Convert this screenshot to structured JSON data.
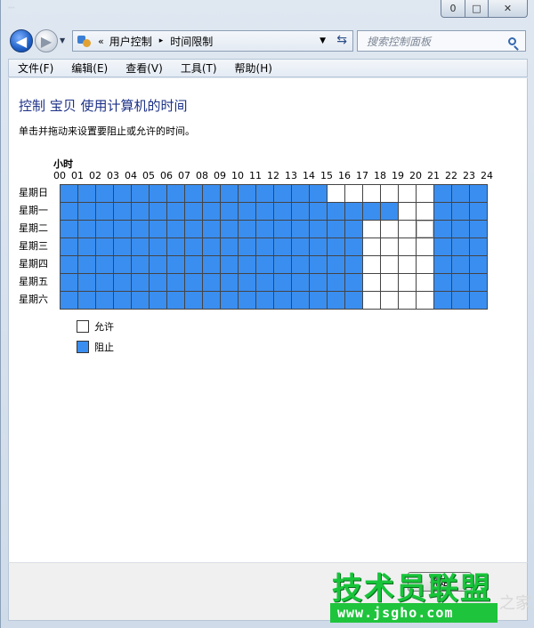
{
  "window": {
    "blurred_title": "...",
    "controls": {
      "minimize": "0",
      "maximize": "□",
      "close": "✕"
    }
  },
  "address_bar": {
    "overflow": "«",
    "crumbs": [
      "用户控制",
      "时间限制"
    ],
    "separator": "▸",
    "search_placeholder": "搜索控制面板"
  },
  "menu": [
    "文件(F)",
    "编辑(E)",
    "查看(V)",
    "工具(T)",
    "帮助(H)"
  ],
  "page": {
    "title": "控制 宝贝 使用计算机的时间",
    "instruction": "单击并拖动来设置要阻止或允许的时间。"
  },
  "grid": {
    "hours_label": "小时",
    "hours": [
      "00",
      "01",
      "02",
      "03",
      "04",
      "05",
      "06",
      "07",
      "08",
      "09",
      "10",
      "11",
      "12",
      "13",
      "14",
      "15",
      "16",
      "17",
      "18",
      "19",
      "20",
      "21",
      "22",
      "23",
      "24"
    ],
    "days": [
      "星期日",
      "星期一",
      "星期二",
      "星期三",
      "星期四",
      "星期五",
      "星期六"
    ],
    "blocked": [
      [
        1,
        1,
        1,
        1,
        1,
        1,
        1,
        1,
        1,
        1,
        1,
        1,
        1,
        1,
        1,
        0,
        0,
        0,
        0,
        0,
        0,
        1,
        1,
        1
      ],
      [
        1,
        1,
        1,
        1,
        1,
        1,
        1,
        1,
        1,
        1,
        1,
        1,
        1,
        1,
        1,
        1,
        1,
        1,
        1,
        0,
        0,
        1,
        1,
        1
      ],
      [
        1,
        1,
        1,
        1,
        1,
        1,
        1,
        1,
        1,
        1,
        1,
        1,
        1,
        1,
        1,
        1,
        1,
        0,
        0,
        0,
        0,
        1,
        1,
        1
      ],
      [
        1,
        1,
        1,
        1,
        1,
        1,
        1,
        1,
        1,
        1,
        1,
        1,
        1,
        1,
        1,
        1,
        1,
        0,
        0,
        0,
        0,
        1,
        1,
        1
      ],
      [
        1,
        1,
        1,
        1,
        1,
        1,
        1,
        1,
        1,
        1,
        1,
        1,
        1,
        1,
        1,
        1,
        1,
        0,
        0,
        0,
        0,
        1,
        1,
        1
      ],
      [
        1,
        1,
        1,
        1,
        1,
        1,
        1,
        1,
        1,
        1,
        1,
        1,
        1,
        1,
        1,
        1,
        1,
        0,
        0,
        0,
        0,
        1,
        1,
        1
      ],
      [
        1,
        1,
        1,
        1,
        1,
        1,
        1,
        1,
        1,
        1,
        1,
        1,
        1,
        1,
        1,
        1,
        1,
        0,
        0,
        0,
        0,
        1,
        1,
        1
      ]
    ],
    "blocked_color": "#3a8ef0",
    "allowed_color": "#ffffff"
  },
  "legend": {
    "allowed": "允许",
    "blocked": "阻止"
  },
  "footer": {
    "ok_label": "确定"
  },
  "watermark": {
    "title": "技术员联盟",
    "url": "www.jsgho.com",
    "tail": "之家"
  }
}
